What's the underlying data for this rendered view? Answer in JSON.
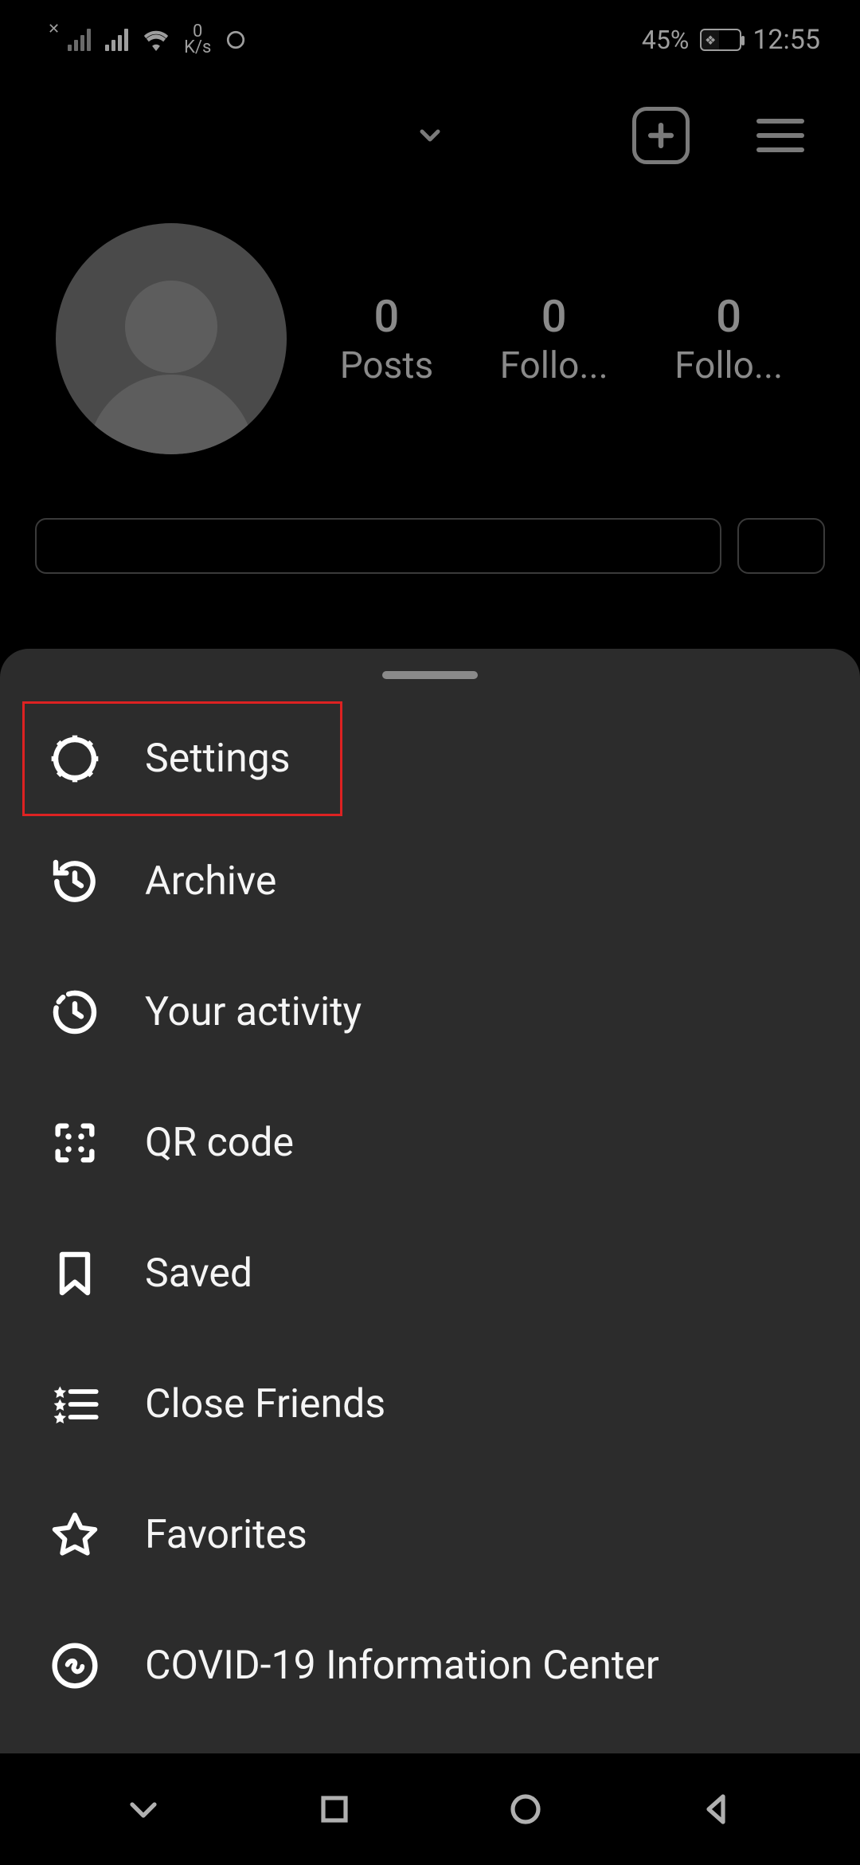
{
  "status": {
    "net_speed_value": "0",
    "net_speed_unit": "K/s",
    "battery_pct": "45%",
    "time": "12:55"
  },
  "profile": {
    "posts_value": "0",
    "posts_label": "Posts",
    "followers_value": "0",
    "followers_label": "Follo...",
    "following_value": "0",
    "following_label": "Follo..."
  },
  "menu": {
    "items": [
      {
        "label": "Settings"
      },
      {
        "label": "Archive"
      },
      {
        "label": "Your activity"
      },
      {
        "label": "QR code"
      },
      {
        "label": "Saved"
      },
      {
        "label": "Close Friends"
      },
      {
        "label": "Favorites"
      },
      {
        "label": "COVID-19 Information Center"
      }
    ]
  }
}
